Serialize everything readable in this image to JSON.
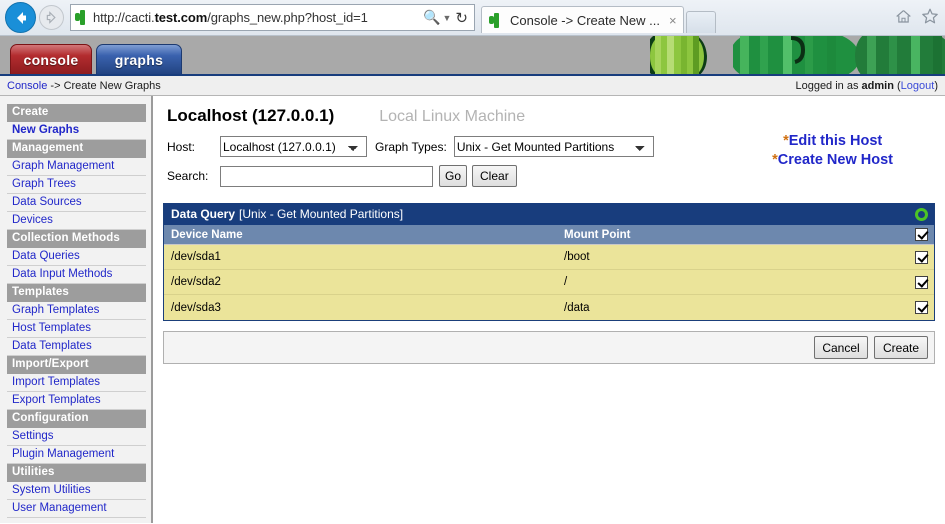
{
  "browser": {
    "back_icon": "arrow-left-icon",
    "forward_icon": "arrow-right-icon",
    "url_prefix": "http://cacti.",
    "url_bold": "test.com",
    "url_suffix": "/graphs_new.php?host_id=1",
    "search_icon": "magnifier-icon",
    "dropdown_icon": "chevron-down-icon",
    "reload_icon": "reload-icon",
    "tab_title": "Console -> Create New ...",
    "tab_close": "×",
    "home_icon": "home-icon",
    "favorites_icon": "star-icon"
  },
  "cacti_tabs": [
    {
      "label": "console",
      "name": "tab-console"
    },
    {
      "label": "graphs",
      "name": "tab-graphs"
    }
  ],
  "breadcrumb": {
    "link": "Console",
    "separator": " -> ",
    "current": "Create New Graphs"
  },
  "login": {
    "prefix": "Logged in as ",
    "user": "admin",
    "logout_open": " (",
    "logout": "Logout",
    "logout_close": ")"
  },
  "sidebar": {
    "items": [
      {
        "type": "header",
        "label": "Create"
      },
      {
        "type": "link",
        "label": "New Graphs",
        "selected": true
      },
      {
        "type": "header",
        "label": "Management"
      },
      {
        "type": "link",
        "label": "Graph Management"
      },
      {
        "type": "link",
        "label": "Graph Trees"
      },
      {
        "type": "link",
        "label": "Data Sources"
      },
      {
        "type": "link",
        "label": "Devices"
      },
      {
        "type": "header",
        "label": "Collection Methods"
      },
      {
        "type": "link",
        "label": "Data Queries"
      },
      {
        "type": "link",
        "label": "Data Input Methods"
      },
      {
        "type": "header",
        "label": "Templates"
      },
      {
        "type": "link",
        "label": "Graph Templates"
      },
      {
        "type": "link",
        "label": "Host Templates"
      },
      {
        "type": "link",
        "label": "Data Templates"
      },
      {
        "type": "header",
        "label": "Import/Export"
      },
      {
        "type": "link",
        "label": "Import Templates"
      },
      {
        "type": "link",
        "label": "Export Templates"
      },
      {
        "type": "header",
        "label": "Configuration"
      },
      {
        "type": "link",
        "label": "Settings"
      },
      {
        "type": "link",
        "label": "Plugin Management"
      },
      {
        "type": "header",
        "label": "Utilities"
      },
      {
        "type": "link",
        "label": "System Utilities"
      },
      {
        "type": "link",
        "label": "User Management"
      }
    ]
  },
  "main": {
    "host_title": "Localhost (127.0.0.1)",
    "host_subtitle": "Local Linux Machine",
    "host_label": "Host:",
    "host_select_value": "Localhost (127.0.0.1)",
    "graph_types_label": "Graph Types:",
    "graph_type_select_value": "Unix - Get Mounted Partitions",
    "search_label": "Search:",
    "search_value": "",
    "search_placeholder": "",
    "go_button": "Go",
    "clear_button": "Clear",
    "actions": {
      "star": "*",
      "edit_host": "Edit this Host",
      "create_host": "Create New Host"
    }
  },
  "data_query": {
    "title": "Data Query",
    "subtitle": "[Unix - Get Mounted Partitions]",
    "collapse_icon": "circle-toggle-icon",
    "columns": {
      "device": "Device Name",
      "mount": "Mount Point"
    },
    "select_all_checked": true,
    "rows": [
      {
        "device": "/dev/sda1",
        "mount": "/boot",
        "checked": true
      },
      {
        "device": "/dev/sda2",
        "mount": "/",
        "checked": true
      },
      {
        "device": "/dev/sda3",
        "mount": "/data",
        "checked": true
      }
    ]
  },
  "action_bar": {
    "cancel": "Cancel",
    "create": "Create"
  },
  "colors": {
    "tab_console": "#b32c2f",
    "tab_graphs": "#3a62ae",
    "dq_header": "#183d7d",
    "dq_colhead": "#6d88ae",
    "row_selected": "#ebe49a",
    "link": "#2127c9",
    "star": "#d07010",
    "collapse_green": "#4cc425"
  }
}
